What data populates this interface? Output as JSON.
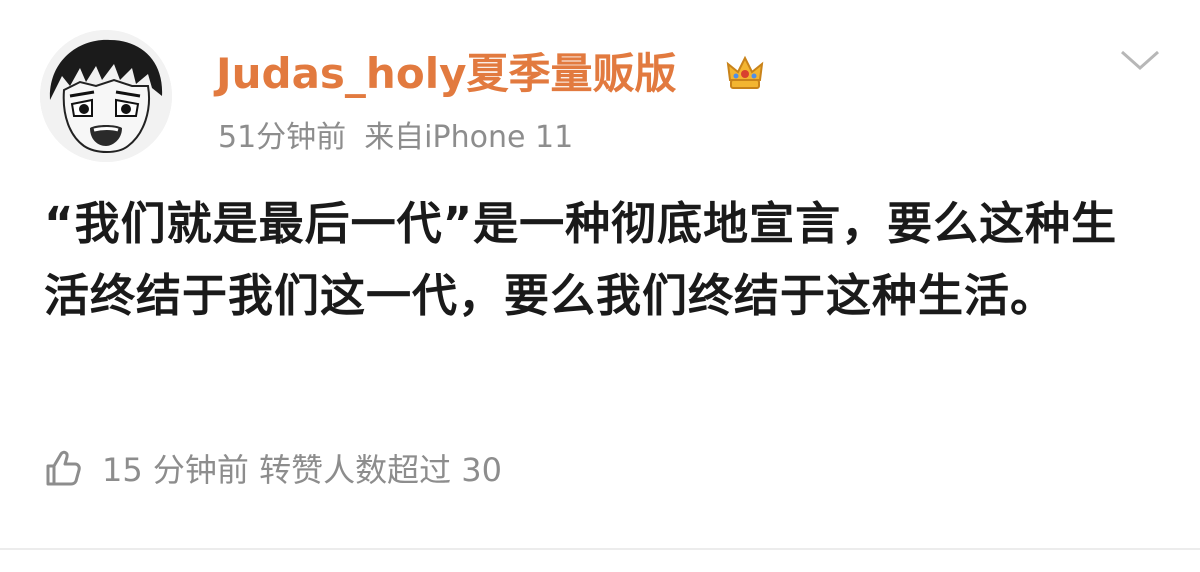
{
  "post": {
    "username": "Judas_holy夏季量贩版",
    "time": "51分钟前",
    "source": "来自iPhone 11",
    "content": "“我们就是最后一代”是一种彻底地宣言，要么这种生活终结于我们这一代，要么我们终结于这种生活。",
    "footer_text": "15 分钟前 转赞人数超过 30"
  },
  "icons": {
    "avatar": "anime-boy-avatar",
    "badge": "crown-icon",
    "menu": "chevron-down-icon",
    "like": "thumbs-up-icon"
  },
  "colors": {
    "username": "#e27a3f",
    "meta": "#8d8d8d",
    "content": "#1a1a1a"
  }
}
